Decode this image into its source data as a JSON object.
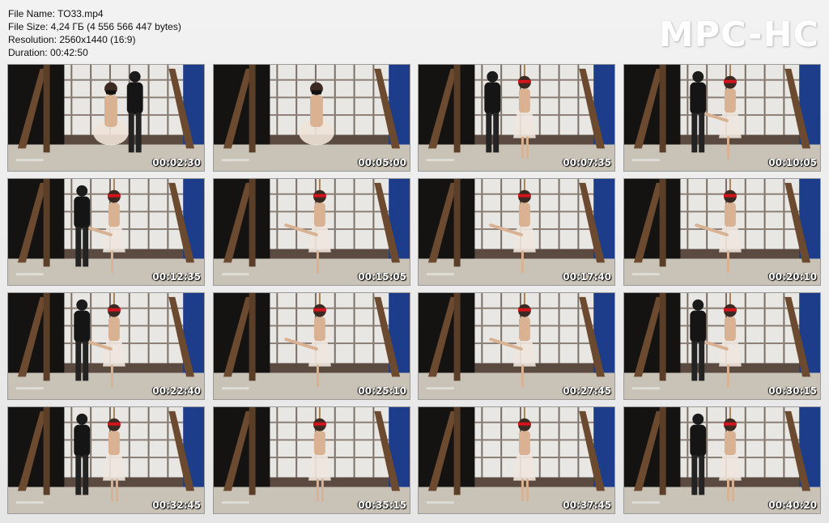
{
  "info": {
    "file_name": "File Name: TO33.mp4",
    "file_size": "File Size: 4,24 ГБ (4 556 566 447 bytes)",
    "resolution": "Resolution: 2560x1440 (16:9)",
    "duration": "Duration: 00:42:50"
  },
  "logo": "MPC-HC",
  "thumbnails": [
    {
      "time": "00:02:30",
      "scene": "kneel",
      "helper": true
    },
    {
      "time": "00:05:00",
      "scene": "kneel",
      "helper": false
    },
    {
      "time": "00:07:35",
      "scene": "stand",
      "helper": true
    },
    {
      "time": "00:10:05",
      "scene": "leg",
      "helper": true
    },
    {
      "time": "00:12:35",
      "scene": "leg",
      "helper": true
    },
    {
      "time": "00:15:05",
      "scene": "leg",
      "helper": false
    },
    {
      "time": "00:17:40",
      "scene": "leg",
      "helper": false
    },
    {
      "time": "00:20:10",
      "scene": "leg",
      "helper": false
    },
    {
      "time": "00:22:40",
      "scene": "leg",
      "helper": true
    },
    {
      "time": "00:25:10",
      "scene": "leg",
      "helper": false
    },
    {
      "time": "00:27:45",
      "scene": "leg",
      "helper": false
    },
    {
      "time": "00:30:15",
      "scene": "leg",
      "helper": true
    },
    {
      "time": "00:32:45",
      "scene": "stand",
      "helper": true
    },
    {
      "time": "00:35:15",
      "scene": "stand",
      "helper": false
    },
    {
      "time": "00:37:45",
      "scene": "stand",
      "helper": false
    },
    {
      "time": "00:40:20",
      "scene": "stand",
      "helper": true
    }
  ]
}
